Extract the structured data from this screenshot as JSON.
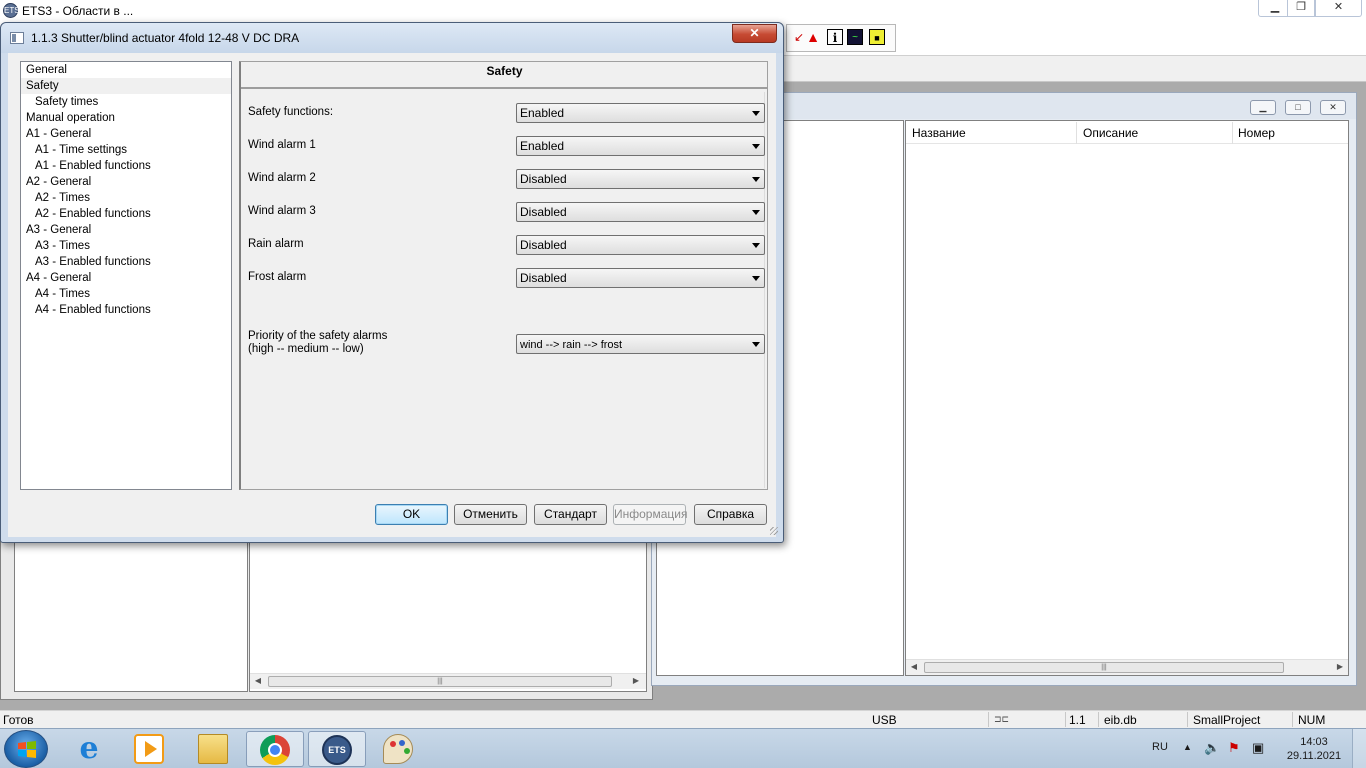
{
  "main_window": {
    "title": "ETS3 - Области в ...",
    "icon_label": "ETS"
  },
  "right_list": {
    "columns": [
      "Название",
      "Описание",
      "Номер"
    ]
  },
  "dialog": {
    "title": "1.1.3 Shutter/blind actuator 4fold 12-48 V DC DRA",
    "close_label": "✕",
    "nav_items": [
      {
        "label": "General"
      },
      {
        "label": "Safety"
      },
      {
        "label": "Safety times"
      },
      {
        "label": "Manual operation"
      },
      {
        "label": "A1 - General"
      },
      {
        "label": "A1 - Time settings"
      },
      {
        "label": "A1 - Enabled functions"
      },
      {
        "label": "A2 - General"
      },
      {
        "label": "A2 - Times"
      },
      {
        "label": "A2 - Enabled functions"
      },
      {
        "label": "A3 - General"
      },
      {
        "label": "A3 - Times"
      },
      {
        "label": "A3 - Enabled functions"
      },
      {
        "label": "A4 - General"
      },
      {
        "label": "A4 - Times"
      },
      {
        "label": "A4 - Enabled functions"
      }
    ],
    "selected_item": "Safety",
    "panel_heading": "Safety",
    "params": [
      {
        "label": "Safety functions:",
        "value": "Enabled"
      },
      {
        "label": "Wind alarm 1",
        "value": "Enabled"
      },
      {
        "label": "Wind alarm 2",
        "value": "Disabled"
      },
      {
        "label": "Wind alarm 3",
        "value": "Disabled"
      },
      {
        "label": "Rain alarm",
        "value": "Disabled"
      },
      {
        "label": "Frost alarm",
        "value": "Disabled"
      }
    ],
    "priority": {
      "label_line1": "Priority of the safety alarms",
      "label_line2": "(high -- medium -- low)",
      "value": "wind --> rain --> frost"
    },
    "buttons": {
      "ok": "OK",
      "cancel": "Отменить",
      "default": "Стандарт",
      "info": "Информация",
      "help": "Справка"
    }
  },
  "status_bar": {
    "ready": "Готов",
    "interface": "USB",
    "address": "1.1",
    "database": "eib.db",
    "project": "SmallProject",
    "num": "NUM"
  },
  "tray": {
    "language": "RU",
    "time": "14:03",
    "date": "29.11.2021"
  },
  "icons": [
    "ets-app-icon",
    "windows-flag-icon",
    "internet-explorer-icon",
    "media-player-icon",
    "file-explorer-icon",
    "chrome-icon",
    "ets-taskbar-icon",
    "paint-icon",
    "speaker-icon",
    "network-icon",
    "flag-icon"
  ]
}
